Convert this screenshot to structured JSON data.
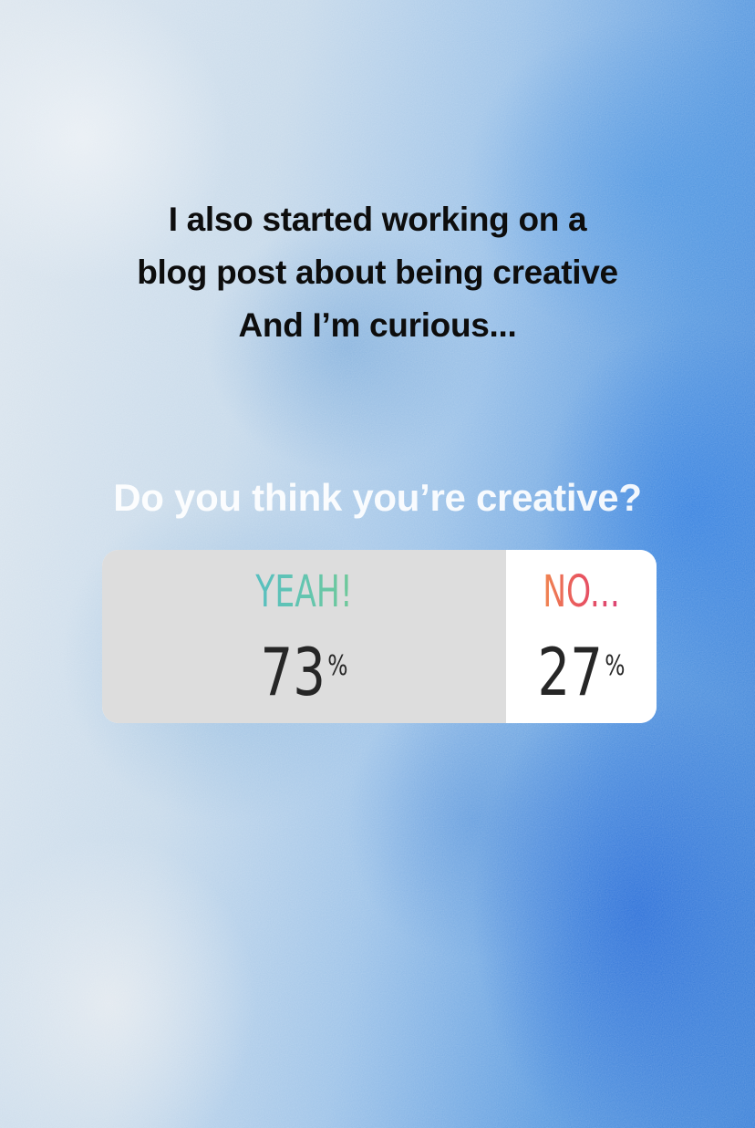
{
  "story": {
    "intro_lines": [
      "I also started working on a",
      "blog post about being creative",
      "And I’m curious..."
    ],
    "poll": {
      "question": "Do you think you’re creative?",
      "options": [
        {
          "label": "YEAH!",
          "percent": "73",
          "percent_sign": "%",
          "share": 0.73
        },
        {
          "label": "NO...",
          "percent": "27",
          "percent_sign": "%",
          "share": 0.27
        }
      ]
    }
  },
  "colors": {
    "yes_label_gradient": [
      "#3fb3e0",
      "#86d06a"
    ],
    "no_label_gradient": [
      "#f39a4a",
      "#d7407e"
    ],
    "winner_fill": "#dddddd",
    "text_dark": "#0d0d0d"
  }
}
